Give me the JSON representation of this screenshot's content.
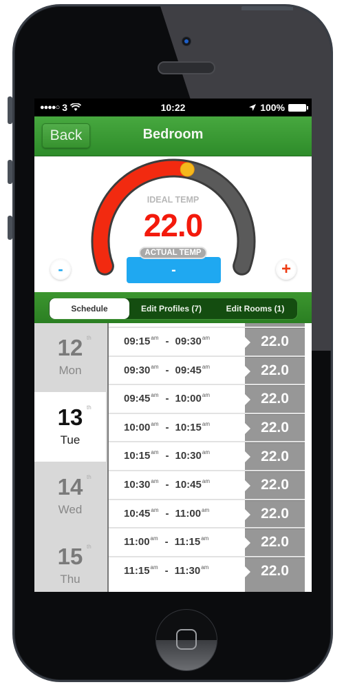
{
  "status_bar": {
    "signal": "●●●●○",
    "carrier": "3",
    "time": "10:22",
    "battery": "100%"
  },
  "nav": {
    "back_label": "Back",
    "title": "Bedroom"
  },
  "thermostat": {
    "ideal_label": "IDEAL TEMP",
    "ideal_value": "22.0",
    "actual_label": "ACTUAL TEMP",
    "actual_value": "-",
    "minus_label": "-",
    "plus_label": "+",
    "dial_fraction": 0.55,
    "colors": {
      "active_arc": "#f22a10",
      "inactive_arc": "#555555",
      "knob": "#f5b81c",
      "actual_box": "#1fa8f1"
    }
  },
  "tabs": [
    {
      "label": "Schedule",
      "active": true
    },
    {
      "label": "Edit Profiles (7)",
      "active": false
    },
    {
      "label": "Edit Rooms (1)",
      "active": false
    }
  ],
  "days": [
    {
      "num": "12",
      "suffix": "th",
      "name": "Mon",
      "active": false
    },
    {
      "num": "13",
      "suffix": "th",
      "name": "Tue",
      "active": true
    },
    {
      "num": "14",
      "suffix": "th",
      "name": "Wed",
      "active": false
    },
    {
      "num": "15",
      "suffix": "th",
      "name": "Thu",
      "active": false
    }
  ],
  "slots": [
    {
      "start": "09:15",
      "end": "09:30",
      "meridiem": "am",
      "temp": "22.0"
    },
    {
      "start": "09:30",
      "end": "09:45",
      "meridiem": "am",
      "temp": "22.0"
    },
    {
      "start": "09:45",
      "end": "10:00",
      "meridiem": "am",
      "temp": "22.0"
    },
    {
      "start": "10:00",
      "end": "10:15",
      "meridiem": "am",
      "temp": "22.0"
    },
    {
      "start": "10:15",
      "end": "10:30",
      "meridiem": "am",
      "temp": "22.0"
    },
    {
      "start": "10:30",
      "end": "10:45",
      "meridiem": "am",
      "temp": "22.0"
    },
    {
      "start": "10:45",
      "end": "11:00",
      "meridiem": "am",
      "temp": "22.0"
    },
    {
      "start": "11:00",
      "end": "11:15",
      "meridiem": "am",
      "temp": "22.0"
    },
    {
      "start": "11:15",
      "end": "11:30",
      "meridiem": "am",
      "temp": "22.0"
    }
  ]
}
